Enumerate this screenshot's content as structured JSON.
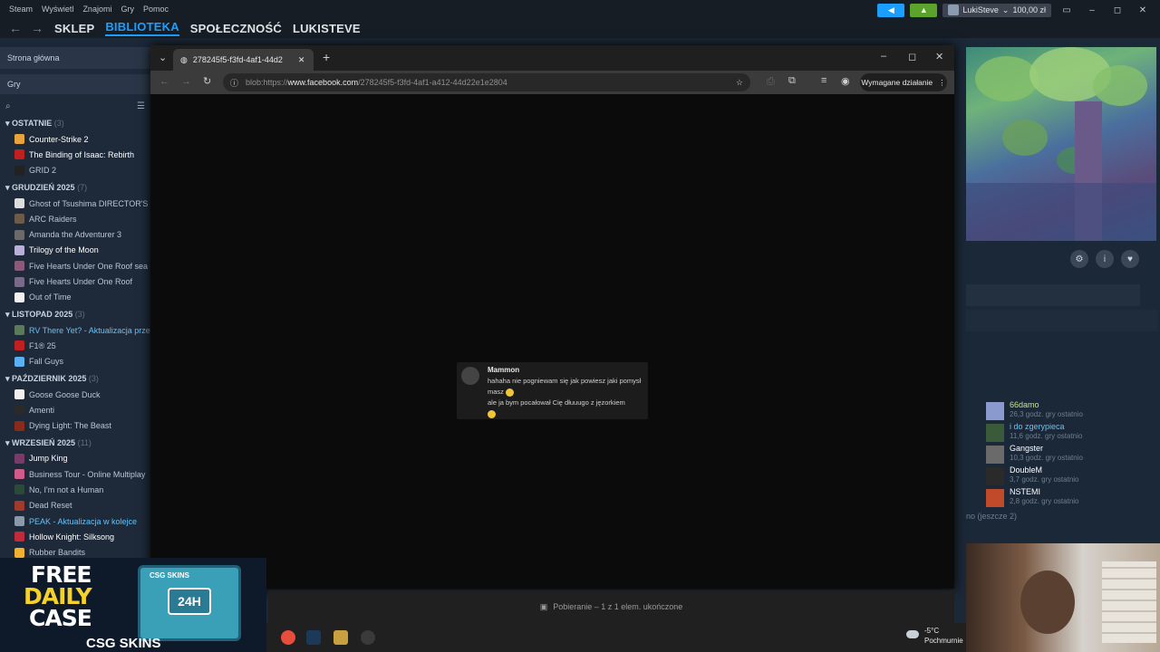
{
  "steam": {
    "menu": [
      "Steam",
      "Wyświetl",
      "Znajomi",
      "Gry",
      "Pomoc"
    ],
    "account_name": "LukiSteve",
    "balance": "100,00 zł",
    "nav": {
      "store": "SKLEP",
      "library": "BIBLIOTEKA",
      "community": "SPOŁECZNOŚĆ",
      "profile": "LUKISTEVE"
    }
  },
  "sidebar": {
    "home": "Strona główna",
    "filter": "Gry",
    "sections": [
      {
        "title": "OSTATNIE",
        "count": "(3)",
        "games": [
          {
            "name": "Counter-Strike 2",
            "style": "bold",
            "color": "#e8a33b"
          },
          {
            "name": "The Binding of Isaac: Rebirth",
            "style": "bold",
            "color": "#c02020"
          },
          {
            "name": "GRID 2",
            "style": "normal",
            "color": "#222222"
          }
        ]
      },
      {
        "title": "GRUDZIEŃ 2025",
        "count": "(7)",
        "games": [
          {
            "name": "Ghost of Tsushima DIRECTOR'S C",
            "style": "normal",
            "color": "#dddddd"
          },
          {
            "name": "ARC Raiders",
            "style": "normal",
            "color": "#6c5a4a"
          },
          {
            "name": "Amanda the Adventurer 3",
            "style": "normal",
            "color": "#6a6a6a"
          },
          {
            "name": "Trilogy of the Moon",
            "style": "bold",
            "color": "#b8b0d8"
          },
          {
            "name": "Five Hearts Under One Roof sea",
            "style": "normal",
            "color": "#8a5a7a"
          },
          {
            "name": "Five Hearts Under One Roof",
            "style": "normal",
            "color": "#7a6a8a"
          },
          {
            "name": "Out of Time",
            "style": "normal",
            "color": "#f2f2f2"
          }
        ]
      },
      {
        "title": "LISTOPAD 2025",
        "count": "(3)",
        "games": [
          {
            "name": "RV There Yet? - Aktualizacja prze",
            "style": "upd",
            "color": "#5a7a5a"
          },
          {
            "name": "F1® 25",
            "style": "normal",
            "color": "#c02020"
          },
          {
            "name": "Fall Guys",
            "style": "normal",
            "color": "#5ab0f0"
          }
        ]
      },
      {
        "title": "PAŹDZIERNIK 2025",
        "count": "(3)",
        "games": [
          {
            "name": "Goose Goose Duck",
            "style": "normal",
            "color": "#f0f0f0"
          },
          {
            "name": "Amenti",
            "style": "normal",
            "color": "#2a2a2a"
          },
          {
            "name": "Dying Light: The Beast",
            "style": "normal",
            "color": "#8a2a1a"
          }
        ]
      },
      {
        "title": "WRZESIEŃ 2025",
        "count": "(11)",
        "games": [
          {
            "name": "Jump King",
            "style": "bold",
            "color": "#7a3a6a"
          },
          {
            "name": "Business Tour - Online Multiplay",
            "style": "normal",
            "color": "#d05a8a"
          },
          {
            "name": "No, I'm not a Human",
            "style": "normal",
            "color": "#2a4a3a"
          },
          {
            "name": "Dead Reset",
            "style": "normal",
            "color": "#a03a2a"
          },
          {
            "name": "PEAK - Aktualizacja w kolejce",
            "style": "upd",
            "color": "#8a9aaa"
          },
          {
            "name": "Hollow Knight: Silksong",
            "style": "bold",
            "color": "#c02a3a"
          },
          {
            "name": "Rubber Bandits",
            "style": "normal",
            "color": "#f0b030"
          }
        ]
      }
    ]
  },
  "browser": {
    "tab_title": "278245f5-f3fd-4af1-44d2",
    "url_prefix": "blob:https://",
    "url_host": "www.facebook.com",
    "url_path": "/278245f5-f3fd-4af1-a412-44d22e1e2804",
    "action_required": "Wymagane działanie",
    "download_status": "Pobieranie – 1 z 1 elem. ukończone"
  },
  "message": {
    "author": "Mammon",
    "line1": "hahaha nie pogniewam się jak powiesz jaki pomysł masz",
    "line2": "ale ja bym pocałował Cię dłuuugo z jęzorkiem"
  },
  "friends": [
    {
      "name": "66damo",
      "time": "26,3 godz. gry ostatnio",
      "color": "#8a9acf",
      "style": "g"
    },
    {
      "name": "i do zgerypieca",
      "time": "11,6 godz. gry ostatnio",
      "color": "#3a5a3a",
      "style": "ig"
    },
    {
      "name": "Gangster",
      "time": "10,3 godz. gry ostatnio",
      "color": "#6a6a6a",
      "style": "n"
    },
    {
      "name": "DoubleM",
      "time": "3,7 godz. gry ostatnio",
      "color": "#2a2a2a",
      "style": "n"
    },
    {
      "name": "NSTEMI",
      "time": "2,8 godz. gry ostatnio",
      "color": "#c04a2a",
      "style": "n"
    }
  ],
  "friends_more": "no (jeszcze 2)",
  "ad": {
    "line1": "FREE",
    "line2": "DAILY",
    "line3": "CASE",
    "badge": "24H",
    "brand": "CSG SKINS",
    "chest_brand": "CSG SKINS"
  },
  "weather": {
    "temp": "-5°C",
    "desc": "Pochmurnie"
  }
}
